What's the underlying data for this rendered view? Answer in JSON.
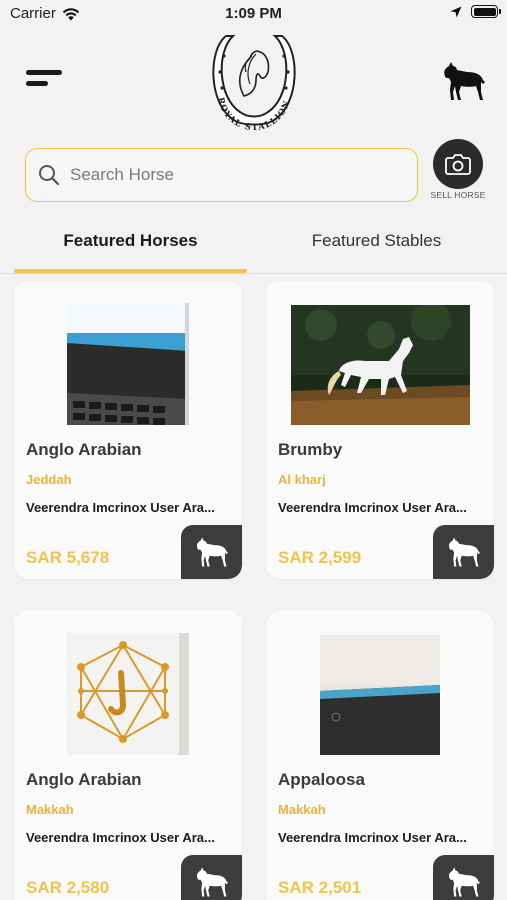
{
  "status_bar": {
    "carrier": "Carrier",
    "time": "1:09 PM"
  },
  "header": {
    "logo_text": "ROYAL STALLION",
    "menu_icon": "hamburger-menu-icon",
    "horse_icon": "horse-silhouette-icon"
  },
  "search": {
    "placeholder": "Search Horse",
    "value": ""
  },
  "sell_button": {
    "label": "SELL HORSE",
    "icon": "camera-icon"
  },
  "tabs": [
    {
      "label": "Featured Horses",
      "active": true
    },
    {
      "label": "Featured Stables",
      "active": false
    }
  ],
  "colors": {
    "accent": "#f0c34a",
    "city": "#eab43a",
    "dark": "#2b2b2b"
  },
  "cards": [
    {
      "name": "Anglo Arabian",
      "city": "Jeddah",
      "user": "Veerendra Imcrinox User Ara...",
      "price": "SAR 5,678",
      "image": "laptop-keyboard-photo"
    },
    {
      "name": "Brumby",
      "city": "Al kharj",
      "user": "Veerendra Imcrinox User Ara...",
      "price": "SAR 2,599",
      "image": "white-horse-running-photo"
    },
    {
      "name": "Anglo Arabian",
      "city": "Makkah",
      "user": "Veerendra Imcrinox User Ara...",
      "price": "SAR 2,580",
      "image": "gold-hexagon-logo-photo"
    },
    {
      "name": "Appaloosa",
      "city": "Makkah",
      "user": "Veerendra Imcrinox User Ara...",
      "price": "SAR 2,501",
      "image": "laptop-edge-photo"
    }
  ]
}
